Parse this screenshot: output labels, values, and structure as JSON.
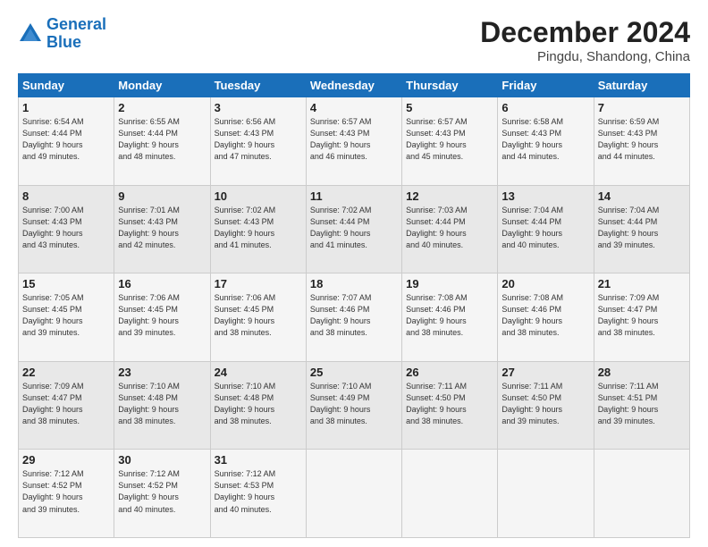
{
  "header": {
    "logo_line1": "General",
    "logo_line2": "Blue",
    "month": "December 2024",
    "location": "Pingdu, Shandong, China"
  },
  "days_of_week": [
    "Sunday",
    "Monday",
    "Tuesday",
    "Wednesday",
    "Thursday",
    "Friday",
    "Saturday"
  ],
  "weeks": [
    [
      {
        "day": "1",
        "info": "Sunrise: 6:54 AM\nSunset: 4:44 PM\nDaylight: 9 hours\nand 49 minutes."
      },
      {
        "day": "2",
        "info": "Sunrise: 6:55 AM\nSunset: 4:44 PM\nDaylight: 9 hours\nand 48 minutes."
      },
      {
        "day": "3",
        "info": "Sunrise: 6:56 AM\nSunset: 4:43 PM\nDaylight: 9 hours\nand 47 minutes."
      },
      {
        "day": "4",
        "info": "Sunrise: 6:57 AM\nSunset: 4:43 PM\nDaylight: 9 hours\nand 46 minutes."
      },
      {
        "day": "5",
        "info": "Sunrise: 6:57 AM\nSunset: 4:43 PM\nDaylight: 9 hours\nand 45 minutes."
      },
      {
        "day": "6",
        "info": "Sunrise: 6:58 AM\nSunset: 4:43 PM\nDaylight: 9 hours\nand 44 minutes."
      },
      {
        "day": "7",
        "info": "Sunrise: 6:59 AM\nSunset: 4:43 PM\nDaylight: 9 hours\nand 44 minutes."
      }
    ],
    [
      {
        "day": "8",
        "info": "Sunrise: 7:00 AM\nSunset: 4:43 PM\nDaylight: 9 hours\nand 43 minutes."
      },
      {
        "day": "9",
        "info": "Sunrise: 7:01 AM\nSunset: 4:43 PM\nDaylight: 9 hours\nand 42 minutes."
      },
      {
        "day": "10",
        "info": "Sunrise: 7:02 AM\nSunset: 4:43 PM\nDaylight: 9 hours\nand 41 minutes."
      },
      {
        "day": "11",
        "info": "Sunrise: 7:02 AM\nSunset: 4:44 PM\nDaylight: 9 hours\nand 41 minutes."
      },
      {
        "day": "12",
        "info": "Sunrise: 7:03 AM\nSunset: 4:44 PM\nDaylight: 9 hours\nand 40 minutes."
      },
      {
        "day": "13",
        "info": "Sunrise: 7:04 AM\nSunset: 4:44 PM\nDaylight: 9 hours\nand 40 minutes."
      },
      {
        "day": "14",
        "info": "Sunrise: 7:04 AM\nSunset: 4:44 PM\nDaylight: 9 hours\nand 39 minutes."
      }
    ],
    [
      {
        "day": "15",
        "info": "Sunrise: 7:05 AM\nSunset: 4:45 PM\nDaylight: 9 hours\nand 39 minutes."
      },
      {
        "day": "16",
        "info": "Sunrise: 7:06 AM\nSunset: 4:45 PM\nDaylight: 9 hours\nand 39 minutes."
      },
      {
        "day": "17",
        "info": "Sunrise: 7:06 AM\nSunset: 4:45 PM\nDaylight: 9 hours\nand 38 minutes."
      },
      {
        "day": "18",
        "info": "Sunrise: 7:07 AM\nSunset: 4:46 PM\nDaylight: 9 hours\nand 38 minutes."
      },
      {
        "day": "19",
        "info": "Sunrise: 7:08 AM\nSunset: 4:46 PM\nDaylight: 9 hours\nand 38 minutes."
      },
      {
        "day": "20",
        "info": "Sunrise: 7:08 AM\nSunset: 4:46 PM\nDaylight: 9 hours\nand 38 minutes."
      },
      {
        "day": "21",
        "info": "Sunrise: 7:09 AM\nSunset: 4:47 PM\nDaylight: 9 hours\nand 38 minutes."
      }
    ],
    [
      {
        "day": "22",
        "info": "Sunrise: 7:09 AM\nSunset: 4:47 PM\nDaylight: 9 hours\nand 38 minutes."
      },
      {
        "day": "23",
        "info": "Sunrise: 7:10 AM\nSunset: 4:48 PM\nDaylight: 9 hours\nand 38 minutes."
      },
      {
        "day": "24",
        "info": "Sunrise: 7:10 AM\nSunset: 4:48 PM\nDaylight: 9 hours\nand 38 minutes."
      },
      {
        "day": "25",
        "info": "Sunrise: 7:10 AM\nSunset: 4:49 PM\nDaylight: 9 hours\nand 38 minutes."
      },
      {
        "day": "26",
        "info": "Sunrise: 7:11 AM\nSunset: 4:50 PM\nDaylight: 9 hours\nand 38 minutes."
      },
      {
        "day": "27",
        "info": "Sunrise: 7:11 AM\nSunset: 4:50 PM\nDaylight: 9 hours\nand 39 minutes."
      },
      {
        "day": "28",
        "info": "Sunrise: 7:11 AM\nSunset: 4:51 PM\nDaylight: 9 hours\nand 39 minutes."
      }
    ],
    [
      {
        "day": "29",
        "info": "Sunrise: 7:12 AM\nSunset: 4:52 PM\nDaylight: 9 hours\nand 39 minutes."
      },
      {
        "day": "30",
        "info": "Sunrise: 7:12 AM\nSunset: 4:52 PM\nDaylight: 9 hours\nand 40 minutes."
      },
      {
        "day": "31",
        "info": "Sunrise: 7:12 AM\nSunset: 4:53 PM\nDaylight: 9 hours\nand 40 minutes."
      },
      null,
      null,
      null,
      null
    ]
  ]
}
